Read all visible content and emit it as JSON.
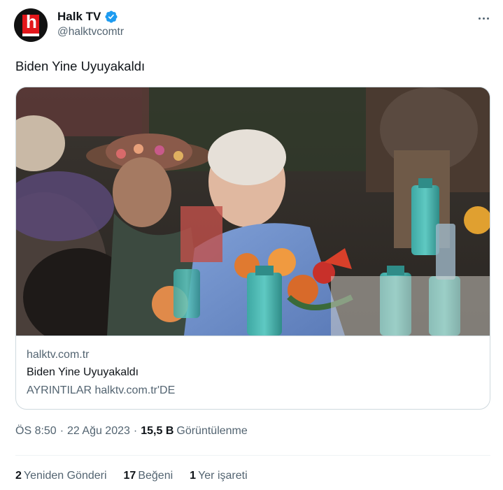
{
  "author": {
    "display_name": "Halk TV",
    "handle": "@halktvcomtr",
    "avatar_logo_text": "h"
  },
  "icons": {
    "verified": "verified-badge-icon",
    "more": "more-options-icon"
  },
  "tweet": {
    "text": "Biden Yine Uyuyakaldı"
  },
  "card": {
    "domain": "halktv.com.tr",
    "title": "Biden Yine Uyuyakaldı",
    "description": "AYRINTILAR halktv.com.tr'DE"
  },
  "meta": {
    "time": "ÖS 8:50",
    "separator": "·",
    "date": "22 Ağu 2023",
    "views_count": "15,5 B",
    "views_label": "Görüntülenme"
  },
  "stats": {
    "reposts_count": "2",
    "reposts_label": "Yeniden Gönderi",
    "likes_count": "17",
    "likes_label": "Beğeni",
    "bookmarks_count": "1",
    "bookmarks_label": "Yer işareti"
  },
  "colors": {
    "brand_red": "#e3171b",
    "verified_blue": "#1d9bf0",
    "text_primary": "#0f1419",
    "text_secondary": "#536471",
    "border": "#cfd9de"
  }
}
